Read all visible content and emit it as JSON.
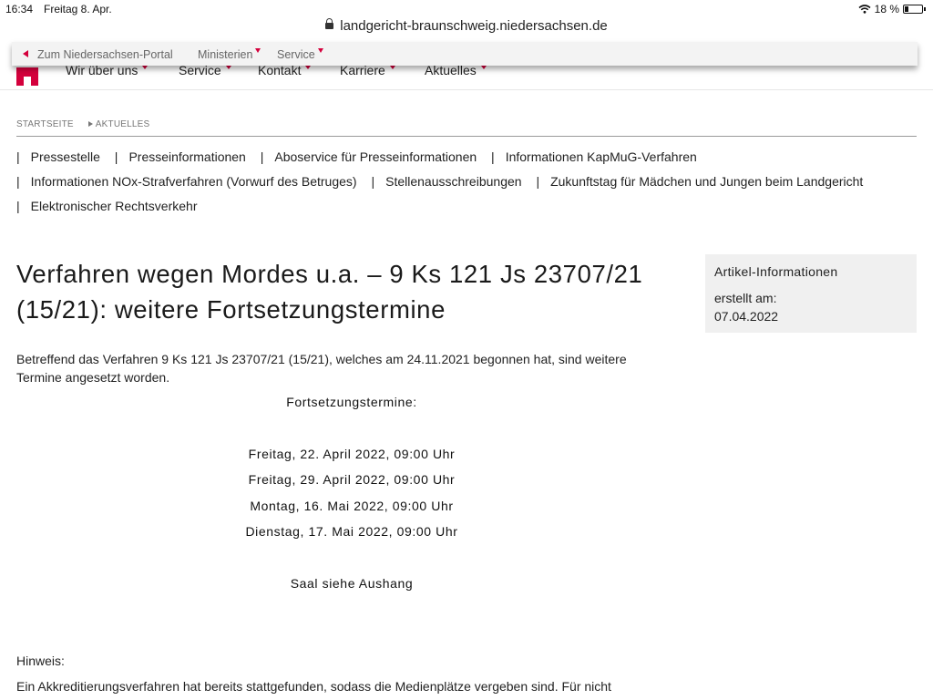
{
  "status_bar": {
    "time": "16:34",
    "date": "Freitag 8. Apr.",
    "battery": "18 %"
  },
  "browser": {
    "url": "landgericht-braunschweig.niedersachsen.de"
  },
  "portal_bar": {
    "items": [
      "Zum Niedersachsen-Portal",
      "Ministerien",
      "Service"
    ]
  },
  "main_nav": {
    "items": [
      "Wir über uns",
      "Service",
      "Kontakt",
      "Karriere",
      "Aktuelles"
    ]
  },
  "breadcrumb": [
    "STARTSEITE",
    "AKTUELLES"
  ],
  "subnav": {
    "separator": "|",
    "items": [
      "Pressestelle",
      "Presseinformationen",
      "Aboservice für Presseinformationen",
      "Informationen KapMuG-Verfahren",
      "Informationen NOx-Strafverfahren (Vorwurf des Betruges)",
      "Stellenausschreibungen",
      "Zukunftstag für Mädchen und Jungen beim Landgericht",
      "Elektronischer Rechtsverkehr"
    ]
  },
  "article": {
    "title": "Verfahren wegen Mordes u.a. – 9 Ks 121 Js 23707/21 (15/21): weitere Fortsetzungstermine",
    "intro": "Betreffend das Verfahren 9 Ks 121 Js 23707/21 (15/21), welches am 24.11.2021 begonnen hat, sind weitere Termine angesetzt worden.",
    "schedule_heading": "Fortsetzungstermine:",
    "dates": [
      "Freitag, 22. April 2022, 09:00 Uhr",
      "Freitag, 29. April 2022, 09:00 Uhr",
      "Montag, 16. Mai 2022, 09:00 Uhr",
      "Dienstag, 17. Mai 2022, 09:00 Uhr"
    ],
    "room": "Saal siehe Aushang",
    "note_label": "Hinweis:",
    "note_text": "Ein Akkreditierungsverfahren hat bereits stattgefunden, sodass die Medienplätze vergeben sind. Für nicht"
  },
  "info_box": {
    "title": "Artikel-Informationen",
    "created_label": "erstellt am:",
    "created_value": "07.04.2022"
  },
  "colors": {
    "accent": "#d4003c",
    "info_box_bg": "#f0f0f0"
  }
}
